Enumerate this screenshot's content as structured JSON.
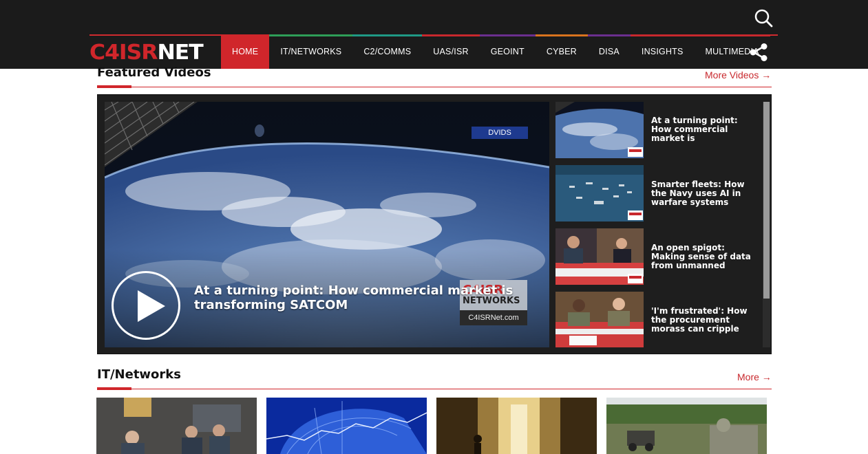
{
  "header": {
    "logo": {
      "part1": "C4ISR",
      "part2": "NET"
    },
    "nav": [
      {
        "label": "HOME",
        "active": true,
        "color": "#d0262b"
      },
      {
        "label": "IT/NETWORKS",
        "active": false,
        "color": "#2e9e58"
      },
      {
        "label": "C2/COMMS",
        "active": false,
        "color": "#1f9a86"
      },
      {
        "label": "UAS/ISR",
        "active": false,
        "color": "#c8282d"
      },
      {
        "label": "GEOINT",
        "active": false,
        "color": "#6b2f8f"
      },
      {
        "label": "CYBER",
        "active": false,
        "color": "#d9731e"
      },
      {
        "label": "DISA",
        "active": false,
        "color": "#6b2f8f"
      },
      {
        "label": "INSIGHTS",
        "active": false,
        "color": "#c8282d"
      },
      {
        "label": "MULTIMEDIA",
        "active": false,
        "color": "#c8282d"
      }
    ],
    "icons": {
      "search": "search-icon",
      "share": "share-icon"
    }
  },
  "featured": {
    "title": "Featured Videos",
    "more": "More Videos →",
    "main_video": {
      "title": "At a turning point: How commercial market is transforming SATCOM",
      "badge": "DVIDS",
      "watermark_line1": "C4ISR",
      "watermark_line2": "NETWORKS",
      "watermark_line3": "C4ISRNet.com"
    },
    "playlist": [
      {
        "title": "At a turning point: How commercial market is"
      },
      {
        "title": "Smarter fleets: How the Navy uses AI in warfare systems"
      },
      {
        "title": "An open spigot: Making sense of data from unmanned"
      },
      {
        "title": "'I'm frustrated': How the procurement morass can cripple"
      }
    ]
  },
  "it_networks": {
    "title": "IT/Networks",
    "more": "More →"
  },
  "colors": {
    "accent": "#d0262b",
    "header_bg": "#1b1b1b",
    "panel_bg": "#1e1e1e"
  }
}
